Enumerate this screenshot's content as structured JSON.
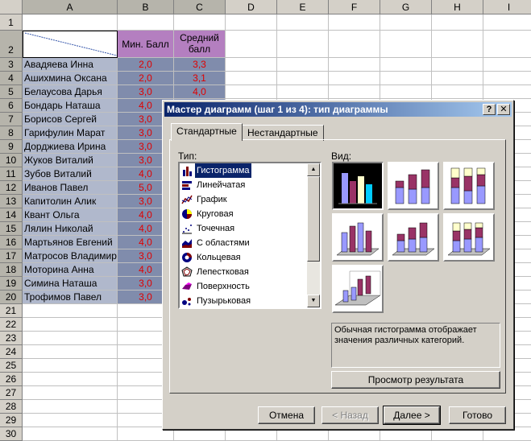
{
  "sheet": {
    "columns": [
      "A",
      "B",
      "C",
      "D",
      "E",
      "F",
      "G",
      "H",
      "I"
    ],
    "row_numbers": [
      "1",
      "2",
      "3",
      "4",
      "5",
      "6",
      "7",
      "8",
      "9",
      "10",
      "11",
      "12",
      "13",
      "14",
      "15",
      "16",
      "17",
      "18",
      "19",
      "20",
      "21",
      "22",
      "23",
      "24",
      "25",
      "26",
      "27",
      "28",
      "29",
      "30"
    ],
    "header_b": "Мин. Балл",
    "header_c": "Средний балл",
    "rows": [
      {
        "name": "Авадяева Инна",
        "min": "2,0",
        "avg": "3,3"
      },
      {
        "name": "Ашихмина Оксана",
        "min": "2,0",
        "avg": "3,1"
      },
      {
        "name": "Белаусова Дарья",
        "min": "3,0",
        "avg": "4,0"
      },
      {
        "name": "Бондарь Наташа",
        "min": "4,0",
        "avg": ""
      },
      {
        "name": "Борисов Сергей",
        "min": "3,0",
        "avg": ""
      },
      {
        "name": "Гарифулин Марат",
        "min": "3,0",
        "avg": ""
      },
      {
        "name": "Дорджиева Ирина",
        "min": "3,0",
        "avg": ""
      },
      {
        "name": "Жуков Виталий",
        "min": "3,0",
        "avg": ""
      },
      {
        "name": "Зубов Виталий",
        "min": "4,0",
        "avg": ""
      },
      {
        "name": "Иванов Павел",
        "min": "5,0",
        "avg": ""
      },
      {
        "name": "Капитолин Алик",
        "min": "3,0",
        "avg": ""
      },
      {
        "name": "Квант Ольга",
        "min": "4,0",
        "avg": ""
      },
      {
        "name": "Лялин Николай",
        "min": "4,0",
        "avg": ""
      },
      {
        "name": "Мартьянов Евгений",
        "min": "4,0",
        "avg": ""
      },
      {
        "name": "Матросов Владимир",
        "min": "3,0",
        "avg": ""
      },
      {
        "name": "Моторина Анна",
        "min": "4,0",
        "avg": ""
      },
      {
        "name": "Симина Наташа",
        "min": "3,0",
        "avg": ""
      },
      {
        "name": "Трофимов Павел",
        "min": "3,0",
        "avg": ""
      }
    ]
  },
  "dialog": {
    "title": "Мастер диаграмм (шаг 1 из 4): тип диаграммы",
    "help_label": "?",
    "close_label": "✕",
    "tabs": [
      {
        "label": "Стандартные",
        "active": true
      },
      {
        "label": "Нестандартные",
        "active": false
      }
    ],
    "type_label": "Тип:",
    "view_label": "Вид:",
    "types": [
      {
        "label": "Гистограмма",
        "icon": "column-chart-icon",
        "selected": true
      },
      {
        "label": "Линейчатая",
        "icon": "bar-chart-icon"
      },
      {
        "label": "График",
        "icon": "line-chart-icon"
      },
      {
        "label": "Круговая",
        "icon": "pie-chart-icon"
      },
      {
        "label": "Точечная",
        "icon": "scatter-chart-icon"
      },
      {
        "label": "С областями",
        "icon": "area-chart-icon"
      },
      {
        "label": "Кольцевая",
        "icon": "doughnut-chart-icon"
      },
      {
        "label": "Лепестковая",
        "icon": "radar-chart-icon"
      },
      {
        "label": "Поверхность",
        "icon": "surface-chart-icon"
      },
      {
        "label": "Пузырьковая",
        "icon": "bubble-chart-icon"
      }
    ],
    "description": "Обычная гистограмма отображает значения различных категорий.",
    "preview_label": "Просмотр результата",
    "buttons": {
      "cancel": "Отмена",
      "back": "< Назад",
      "next": "Далее >",
      "finish": "Готово"
    },
    "colors": {
      "accent": "#0a246a",
      "series1": "#9999ff",
      "series2": "#993366",
      "series3": "#ffffcc"
    }
  }
}
